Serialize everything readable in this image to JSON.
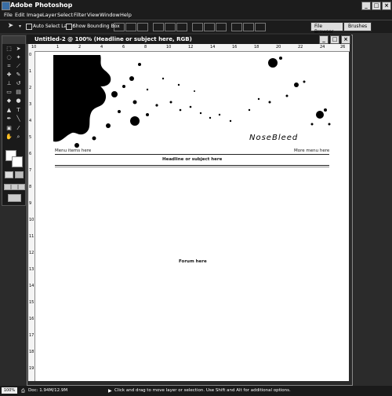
{
  "app": {
    "title": "Adobe Photoshop"
  },
  "menu": [
    "File",
    "Edit",
    "Image",
    "Layer",
    "Select",
    "Filter",
    "View",
    "Window",
    "Help"
  ],
  "options": {
    "auto_select": "Auto Select Layer",
    "bounding_box": "Show Bounding Box"
  },
  "palette_well": {
    "tab1": "File Browser",
    "tab2": "Brushes"
  },
  "document": {
    "title": "Untitled-2 @ 100% (Headline or subject here, RGB)",
    "ruler_top": [
      "10",
      "1",
      "2",
      "4",
      "6",
      "8",
      "10",
      "12",
      "14",
      "16",
      "18",
      "20",
      "22",
      "24",
      "26"
    ],
    "ruler_left": [
      "0",
      "1",
      "2",
      "3",
      "4",
      "5",
      "6",
      "7",
      "8",
      "9",
      "10",
      "11",
      "12",
      "13",
      "14",
      "15",
      "16",
      "17",
      "18",
      "19"
    ],
    "logo": "NoseBleed",
    "menu_left": "Menu items here",
    "menu_right": "More menu here",
    "headline": "Headline or subject here",
    "forum": "Forum here"
  },
  "status": {
    "zoom": "100%",
    "doc": "Doc: 1.94M/12.9M",
    "hint": "Click and drag to move layer or selection. Use Shift and Alt for additional options."
  }
}
